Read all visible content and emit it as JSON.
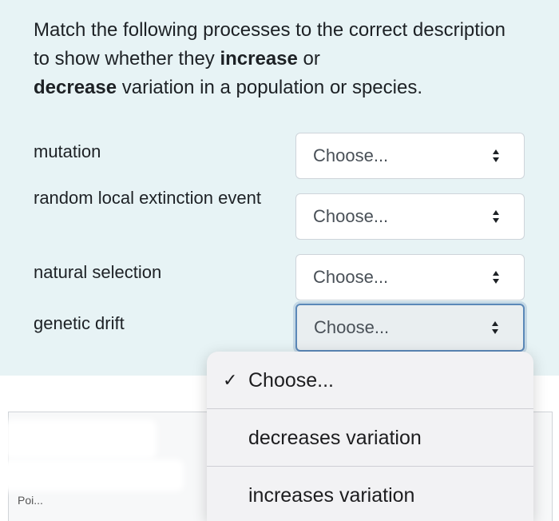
{
  "question": {
    "prompt_part1": "Match the following processes to the correct description to show whether they ",
    "prompt_bold1": "increase",
    "prompt_part2": " or ",
    "prompt_bold2": "decrease",
    "prompt_part3": " variation in a population or species."
  },
  "rows": [
    {
      "label": "mutation",
      "selected": "Choose..."
    },
    {
      "label": "random local extinction event",
      "selected": "Choose..."
    },
    {
      "label": "natural selection",
      "selected": "Choose..."
    },
    {
      "label": "genetic drift",
      "selected": "Choose..."
    }
  ],
  "dropdown": {
    "options": [
      {
        "label": "Choose...",
        "checked": true
      },
      {
        "label": "decreases variation",
        "checked": false
      },
      {
        "label": "increases variation",
        "checked": false
      }
    ],
    "check_glyph": "✓"
  },
  "lower": {
    "partial_text": "Poi..."
  },
  "colors": {
    "panel_bg": "#e7f3f5",
    "focus_border": "#5b88b8"
  }
}
